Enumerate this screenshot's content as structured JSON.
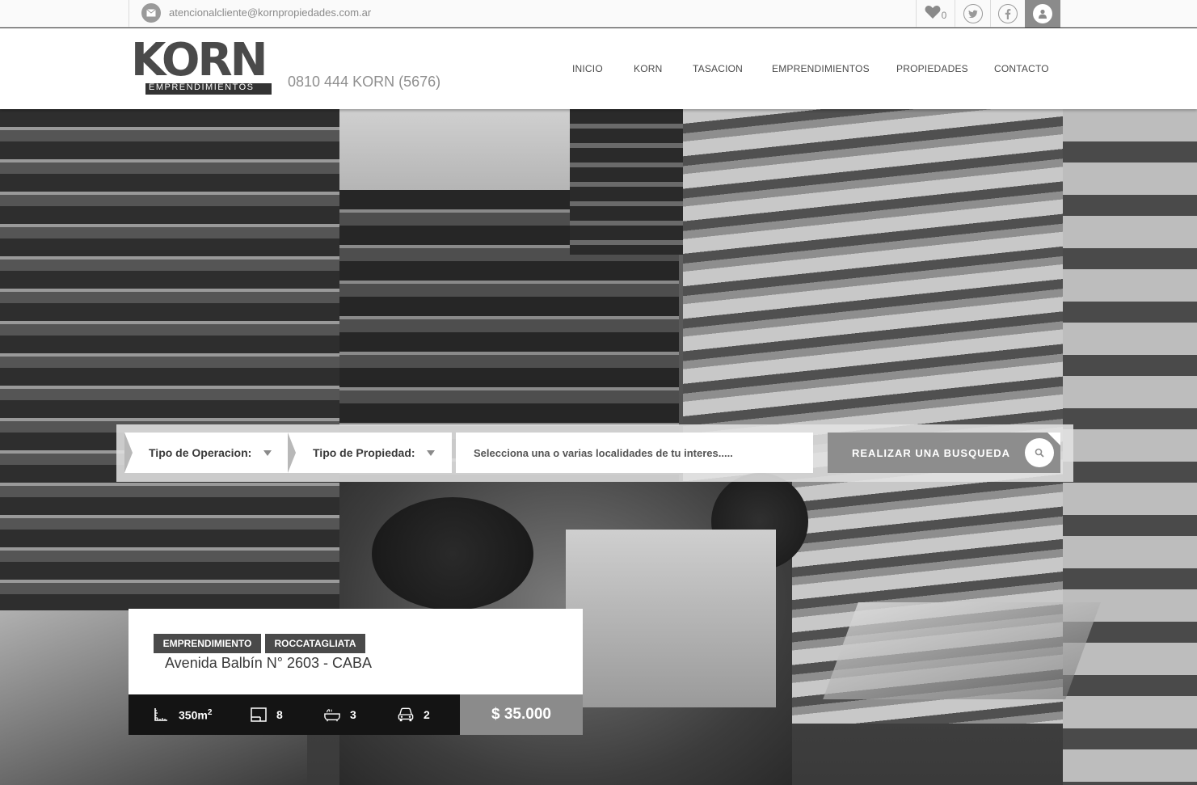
{
  "topbar": {
    "email": "atencionalcliente@kornpropiedades.com.ar",
    "favorites_count": "0",
    "icons": [
      "mail-icon",
      "heart-icon",
      "twitter-icon",
      "facebook-icon",
      "user-icon"
    ]
  },
  "header": {
    "logo_word": "KORN",
    "logo_subtitle": "EMPRENDIMIENTOS",
    "phone": "0810 444 KORN (5676)",
    "nav": [
      "INICIO",
      "KORN",
      "TASACION",
      "EMPRENDIMIENTOS",
      "PROPIEDADES",
      "CONTACTO"
    ]
  },
  "search": {
    "operation_label": "Tipo de Operacion:",
    "property_label": "Tipo de Propiedad:",
    "location_placeholder": "Selecciona una o varias localidades de tu interes.....",
    "button_label": "REALIZAR UNA BUSQUEDA"
  },
  "featured": {
    "badges": [
      "EMPRENDIMIENTO",
      "ROCCATAGLIATA"
    ],
    "address": "Avenida Balbín N° 2603 - CABA",
    "area": "350m",
    "area_sup": "2",
    "rooms": "8",
    "baths": "3",
    "parking": "2",
    "price": "$ 35.000"
  },
  "colors": {
    "accent": "#8b8b8b",
    "dark": "#141414",
    "badge": "#4a4a4a"
  }
}
